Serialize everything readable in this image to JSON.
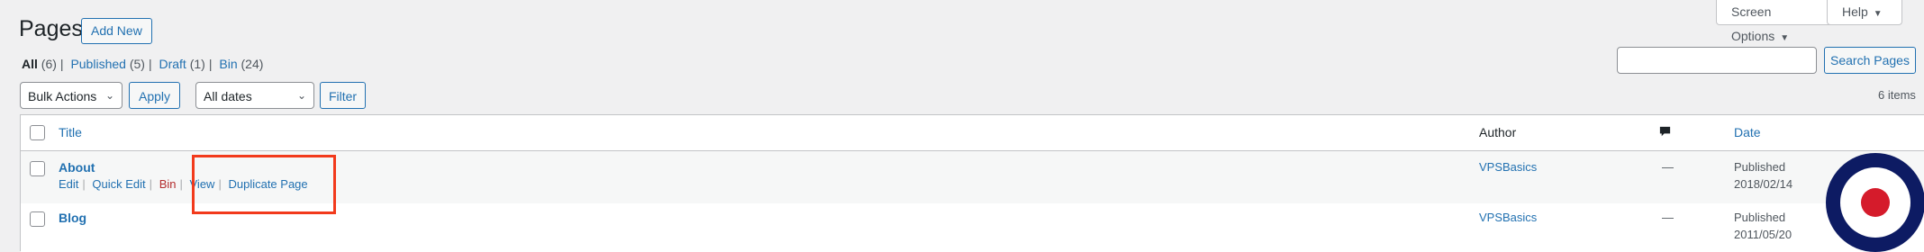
{
  "header": {
    "title": "Pages",
    "add_new_label": "Add New",
    "screen_options_label": "Screen Options",
    "help_label": "Help"
  },
  "views": [
    {
      "label": "All",
      "count": "(6)"
    },
    {
      "label": "Published",
      "count": "(5)"
    },
    {
      "label": "Draft",
      "count": "(1)"
    },
    {
      "label": "Bin",
      "count": "(24)"
    }
  ],
  "search": {
    "button_label": "Search Pages",
    "value": ""
  },
  "toolbar": {
    "bulk_actions_selected": "Bulk Actions",
    "apply_label": "Apply",
    "dates_selected": "All dates",
    "filter_label": "Filter",
    "items_count": "6 items"
  },
  "table": {
    "columns": {
      "title": "Title",
      "author": "Author",
      "date": "Date"
    },
    "rows": [
      {
        "title": "About",
        "author": "VPSBasics",
        "comments": "—",
        "status": "Published",
        "date": "2018/02/14",
        "actions": {
          "edit": "Edit",
          "quick_edit": "Quick Edit",
          "bin": "Bin",
          "view": "View",
          "duplicate": "Duplicate Page"
        }
      },
      {
        "title": "Blog",
        "author": "VPSBasics",
        "comments": "—",
        "status": "Published",
        "date": "2011/05/20"
      }
    ]
  },
  "colors": {
    "accent": "#2271b1",
    "trash": "#b32d2e",
    "highlight": "#f23a1c"
  }
}
